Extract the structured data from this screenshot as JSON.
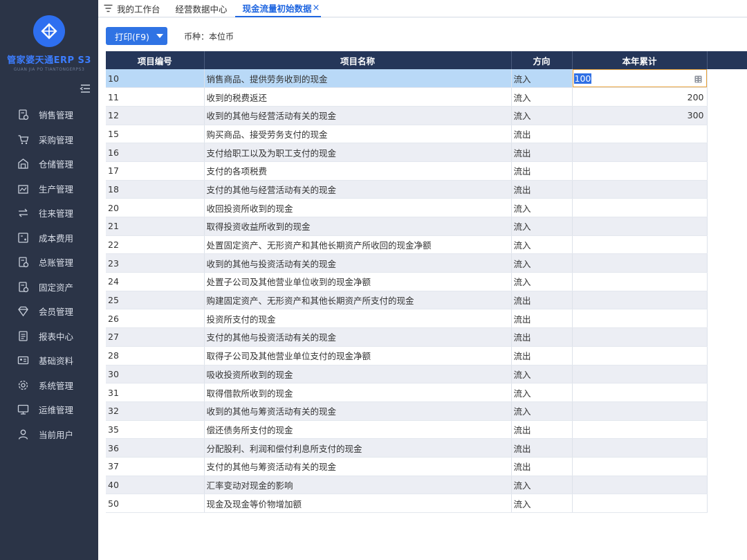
{
  "sidebar": {
    "brand": "管家婆天通ERP S3",
    "brand_sub": "GUAN JIA PO TIANTONGERPS3",
    "items": [
      {
        "label": "销售管理",
        "icon": "sales-icon"
      },
      {
        "label": "采购管理",
        "icon": "cart-icon"
      },
      {
        "label": "仓储管理",
        "icon": "warehouse-icon"
      },
      {
        "label": "生产管理",
        "icon": "factory-icon"
      },
      {
        "label": "往来管理",
        "icon": "exchange-icon"
      },
      {
        "label": "成本费用",
        "icon": "calculator-icon"
      },
      {
        "label": "总账管理",
        "icon": "ledger-icon"
      },
      {
        "label": "固定资产",
        "icon": "asset-icon"
      },
      {
        "label": "会员管理",
        "icon": "diamond-icon"
      },
      {
        "label": "报表中心",
        "icon": "report-icon"
      },
      {
        "label": "基础资料",
        "icon": "id-card-icon"
      },
      {
        "label": "系统管理",
        "icon": "gear-icon"
      },
      {
        "label": "运维管理",
        "icon": "monitor-icon"
      },
      {
        "label": "当前用户",
        "icon": "user-icon"
      }
    ]
  },
  "tabs": [
    {
      "label": "我的工作台"
    },
    {
      "label": "经营数据中心"
    },
    {
      "label": "现金流量初始数据",
      "close": "×"
    }
  ],
  "toolbar": {
    "print_label": "打印(F9)",
    "currency_label": "币种：本位币"
  },
  "table": {
    "headers": [
      "项目编号",
      "项目名称",
      "方向",
      "本年累计"
    ],
    "rows": [
      {
        "code": "10",
        "name": "销售商品、提供劳务收到的现金",
        "dir": "流入",
        "amount": "100"
      },
      {
        "code": "11",
        "name": "收到的税费返还",
        "dir": "流入",
        "amount": "200"
      },
      {
        "code": "12",
        "name": "收到的其他与经营活动有关的现金",
        "dir": "流入",
        "amount": "300"
      },
      {
        "code": "15",
        "name": "购买商品、接受劳务支付的现金",
        "dir": "流出",
        "amount": ""
      },
      {
        "code": "16",
        "name": "支付给职工以及为职工支付的现金",
        "dir": "流出",
        "amount": ""
      },
      {
        "code": "17",
        "name": "支付的各项税费",
        "dir": "流出",
        "amount": ""
      },
      {
        "code": "18",
        "name": "支付的其他与经营活动有关的现金",
        "dir": "流出",
        "amount": ""
      },
      {
        "code": "20",
        "name": "收回投资所收到的现金",
        "dir": "流入",
        "amount": ""
      },
      {
        "code": "21",
        "name": "取得投资收益所收到的现金",
        "dir": "流入",
        "amount": ""
      },
      {
        "code": "22",
        "name": "处置固定资产、无形资产和其他长期资产所收回的现金净额",
        "dir": "流入",
        "amount": ""
      },
      {
        "code": "23",
        "name": "收到的其他与投资活动有关的现金",
        "dir": "流入",
        "amount": ""
      },
      {
        "code": "24",
        "name": "处置子公司及其他营业单位收到的现金净额",
        "dir": "流入",
        "amount": ""
      },
      {
        "code": "25",
        "name": "购建固定资产、无形资产和其他长期资产所支付的现金",
        "dir": "流出",
        "amount": ""
      },
      {
        "code": "26",
        "name": "投资所支付的现金",
        "dir": "流出",
        "amount": ""
      },
      {
        "code": "27",
        "name": "支付的其他与投资活动有关的现金",
        "dir": "流出",
        "amount": ""
      },
      {
        "code": "28",
        "name": "取得子公司及其他营业单位支付的现金净额",
        "dir": "流出",
        "amount": ""
      },
      {
        "code": "30",
        "name": "吸收投资所收到的现金",
        "dir": "流入",
        "amount": ""
      },
      {
        "code": "31",
        "name": "取得借款所收到的现金",
        "dir": "流入",
        "amount": ""
      },
      {
        "code": "32",
        "name": "收到的其他与筹资活动有关的现金",
        "dir": "流入",
        "amount": ""
      },
      {
        "code": "35",
        "name": "偿还债务所支付的现金",
        "dir": "流出",
        "amount": ""
      },
      {
        "code": "36",
        "name": "分配股利、利润和偿付利息所支付的现金",
        "dir": "流出",
        "amount": ""
      },
      {
        "code": "37",
        "name": "支付的其他与筹资活动有关的现金",
        "dir": "流出",
        "amount": ""
      },
      {
        "code": "40",
        "name": "汇率变动对现金的影响",
        "dir": "流入",
        "amount": ""
      },
      {
        "code": "50",
        "name": "现金及现金等价物增加额",
        "dir": "流入",
        "amount": ""
      }
    ]
  },
  "colors": {
    "sidebar_bg": "#2b3447",
    "header_bg": "#253659",
    "accent": "#2f73e4",
    "selected_row": "#b9d9f7"
  }
}
